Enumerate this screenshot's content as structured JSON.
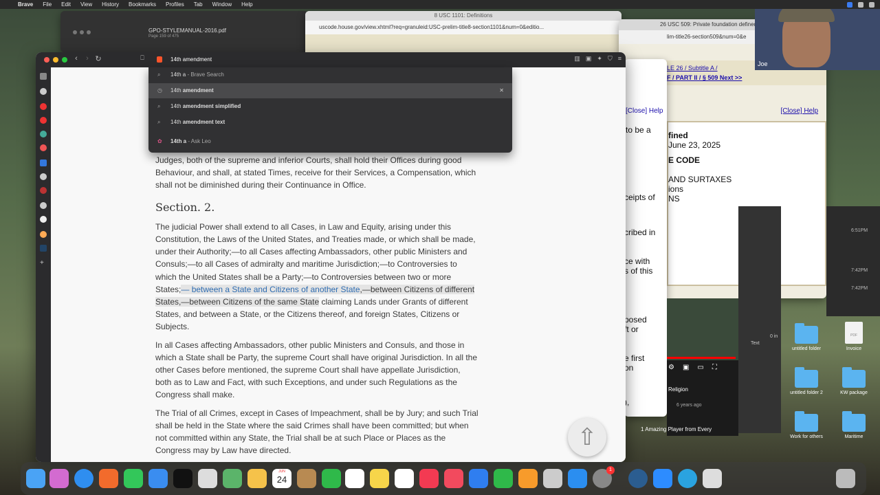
{
  "menubar": {
    "app": "Brave",
    "items": [
      "File",
      "Edit",
      "View",
      "History",
      "Bookmarks",
      "Profiles",
      "Tab",
      "Window",
      "Help"
    ]
  },
  "bg_pdf": {
    "title": "GPO-STYLEMANUAL-2016.pdf",
    "sub": "Page 159 of 475"
  },
  "bg_usc": {
    "tab": "8 USC 1101: Definitions",
    "url": "uscode.house.gov/view.xhtml?req=granuleid:USC-prelim-title8-section1101&num=0&editio..."
  },
  "bg_usc2": {
    "tab": "26 USC 509: Private foundation defined",
    "url": "lim-title26-section509&num=0&e",
    "nav": "LE 26 / Subtitle A /",
    "nav2": "F / PART II / § 509   Next >>",
    "close_help_1": "[Close]  Help",
    "close_help_2": "[Close]  Help",
    "frag1": "to be a",
    "frag2": "fined",
    "frag3": "June 23, 2025",
    "frag4": "E CODE",
    "frag5": "AND SURTAXES",
    "frag6": "ions",
    "frag7": "NS",
    "frag8": "ceipts of",
    "frag9": "cribed in",
    "frag10": "ce with",
    "frag11": "s of this",
    "frag12": "posed",
    "frag13": "ft or",
    "frag14": "e first",
    "frag15": "on",
    "frag16": "),"
  },
  "video": {
    "title": "Religion",
    "meta": "6 years ago",
    "title2": "1 Amazing Player from Every"
  },
  "side_panel": {
    "text": "Text",
    "zoom": "0 in"
  },
  "times": [
    "6:51PM",
    "7:42PM",
    "7:42PM"
  ],
  "facecam": {
    "name": "Joe"
  },
  "desktop_icons": [
    {
      "label": "untitled folder",
      "type": "folder"
    },
    {
      "label": "Invoice",
      "type": "pdf"
    },
    {
      "label": "untitled folder 2",
      "type": "folder"
    },
    {
      "label": "KW package",
      "type": "folder"
    },
    {
      "label": "Work for others",
      "type": "folder"
    },
    {
      "label": "Maritime",
      "type": "folder"
    }
  ],
  "browser": {
    "omnibox_value": "14th amendment",
    "suggestions": [
      {
        "prefix": "14th a",
        "suffix": " - Brave Search",
        "kind": "search"
      },
      {
        "prefix": "14th ",
        "suffix": "amendment",
        "kind": "history",
        "selected": true
      },
      {
        "prefix": "14th ",
        "suffix": "amendment simplified",
        "kind": "search"
      },
      {
        "prefix": "14th ",
        "suffix": "amendment text",
        "kind": "search"
      },
      {
        "prefix": "14th a",
        "suffix": " - Ask Leo",
        "kind": "leo"
      }
    ]
  },
  "document": {
    "para0": "Judges, both of the supreme and inferior Courts, shall hold their Offices during good Behaviour, and shall, at stated Times, receive for their Services, a Compensation, which shall not be diminished during their Continuance in Office.",
    "section_heading": "Section. 2.",
    "para1_start": "The judicial Power shall extend to all Cases, in Law and Equity, arising under this Constitution, the Laws of the United States, and Treaties made, or which shall be made, under their Authority;—to all Cases affecting Ambassadors, other public Ministers and Consuls;—to all Cases of admiralty and maritime Jurisdiction;—to Controversies to which the United States shall be a Party;—to Controversies between two or more States;",
    "para1_link": "— between a State and Citizens of another State",
    "para1_hl": ",—between Citizens of different States,—between Citizens of the same State",
    "para1_end": " claiming Lands under Grants of different States, and between a State, or the Citizens thereof, and foreign States, Citizens or Subjects.",
    "para2": "In all Cases affecting Ambassadors, other public Ministers and Consuls, and those in which a State shall be Party, the supreme Court shall have original Jurisdiction. In all the other Cases before mentioned, the supreme Court shall have appellate Jurisdiction, both as to Law and Fact, with such Exceptions, and under such Regulations as the Congress shall make.",
    "para3": "The Trial of all Crimes, except in Cases of Impeachment, shall be by Jury; and such Trial shall be held in the State where the said Crimes shall have been committed; but when not committed within any State, the Trial shall be at such Place or Places as the Congress may by Law have directed."
  },
  "dock": {
    "calendar_month": "JUN",
    "calendar_day": "24",
    "badge": "1"
  }
}
